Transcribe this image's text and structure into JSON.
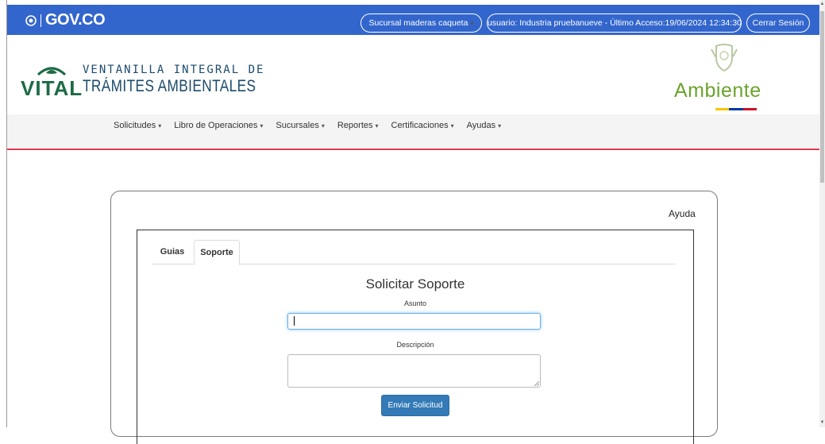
{
  "topbar": {
    "gov_logo": "GOV.CO",
    "branch_label": "Sucursal maderas caqueta",
    "user_label": "usuario: Industria pruebanueve - Último Acceso:19/06/2024 12:34:30",
    "logout_label": "Cerrar Sesión",
    "bar_color": "#3366cc"
  },
  "header": {
    "vital_word": "VITAL",
    "vital_line1": "VENTANILLA INTEGRAL DE",
    "vital_line2": "TRÁMITES AMBIENTALES",
    "ambiente_word": "Ambiente",
    "flag_colors": [
      "#f7c600",
      "#0038a8",
      "#ce1126"
    ]
  },
  "nav": {
    "items": [
      {
        "label": "Solicitudes",
        "icon": "caret-down-icon"
      },
      {
        "label": "Libro de Operaciones",
        "icon": "caret-down-icon"
      },
      {
        "label": "Sucursales",
        "icon": "caret-down-icon"
      },
      {
        "label": "Reportes",
        "icon": "caret-down-icon"
      },
      {
        "label": "Certificaciones",
        "icon": "caret-down-icon"
      },
      {
        "label": "Ayudas",
        "icon": "caret-down-icon"
      }
    ],
    "accent_color": "#e2384f"
  },
  "main": {
    "help_link": "Ayuda",
    "tabs": [
      {
        "label": "Guias",
        "active": false
      },
      {
        "label": "Soporte",
        "active": true
      }
    ],
    "form": {
      "title": "Solicitar Soporte",
      "subject_label": "Asunto",
      "subject_value": "",
      "description_label": "Descripción",
      "description_value": "",
      "submit_label": "Enviar Solicitud",
      "submit_color": "#337ab7"
    }
  }
}
